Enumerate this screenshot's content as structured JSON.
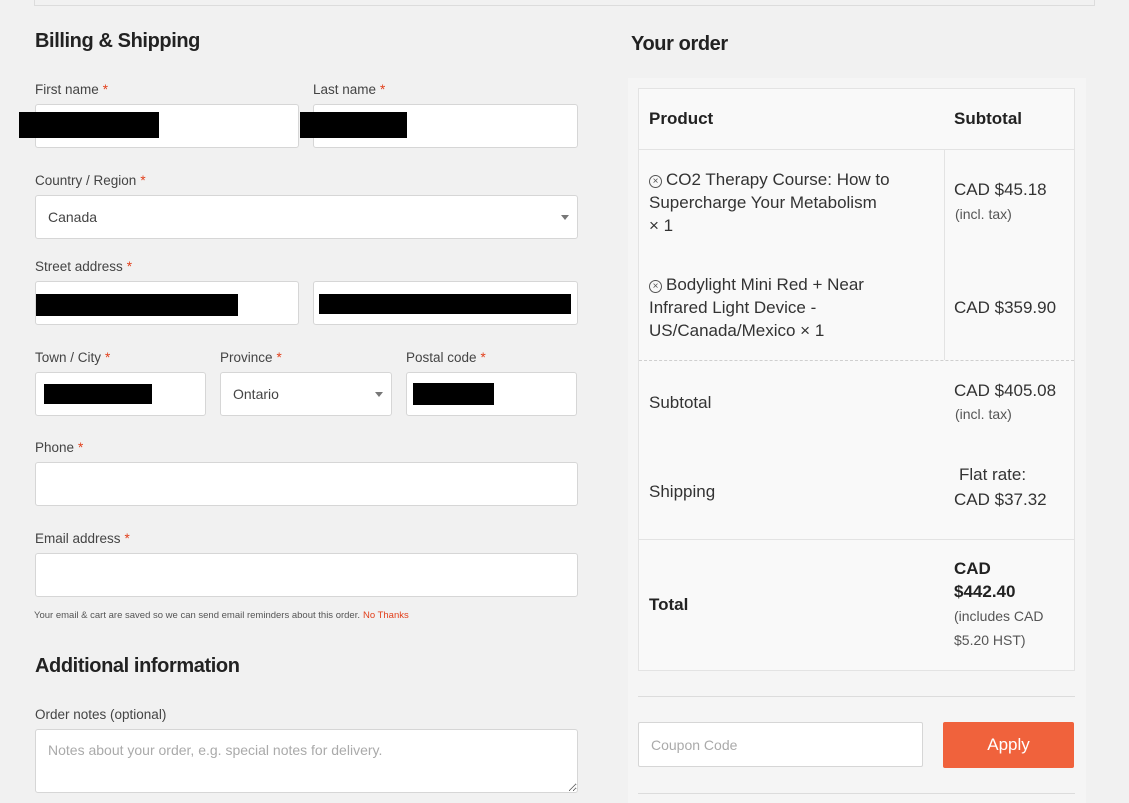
{
  "billing": {
    "title": "Billing & Shipping",
    "required_mark": "*",
    "first_name": {
      "label": "First name",
      "value": ""
    },
    "last_name": {
      "label": "Last name",
      "value": ""
    },
    "country": {
      "label": "Country / Region",
      "value": "Canada"
    },
    "street": {
      "label": "Street address",
      "value_1": "",
      "value_2": ""
    },
    "town": {
      "label": "Town / City",
      "value": ""
    },
    "province": {
      "label": "Province",
      "value": "Ontario"
    },
    "postal": {
      "label": "Postal code",
      "value": ""
    },
    "phone": {
      "label": "Phone",
      "value": ""
    },
    "email": {
      "label": "Email address",
      "value": ""
    },
    "email_note": "Your email & cart are saved so we can send email reminders about this order.",
    "no_thanks": "No Thanks"
  },
  "additional": {
    "title": "Additional information",
    "notes_label": "Order notes (optional)",
    "notes_placeholder": "Notes about your order, e.g. special notes for delivery."
  },
  "order": {
    "title": "Your order",
    "col_product": "Product",
    "col_subtotal": "Subtotal",
    "items": [
      {
        "name_line1": "CO2 Therapy Course: How to",
        "name_line2": "Supercharge Your Metabolism",
        "name_line3": "× 1",
        "price": "CAD $45.18",
        "tax_note": "(incl. tax)"
      },
      {
        "name_line1": "Bodylight Mini Red + Near",
        "name_line2": "Infrared Light Device -",
        "name_line3": "US/Canada/Mexico  × 1",
        "price": "CAD $359.90"
      }
    ],
    "subtotal_label": "Subtotal",
    "subtotal_value": "CAD $405.08",
    "subtotal_tax_note": "(incl. tax)",
    "shipping_label": "Shipping",
    "shipping_line1": "Flat rate:",
    "shipping_line2": "CAD $37.32",
    "total_label": "Total",
    "total_line1": "CAD",
    "total_line2": "$442.40",
    "total_note_line1": "(includes CAD",
    "total_note_line2": "$5.20 HST)"
  },
  "coupon": {
    "placeholder": "Coupon Code",
    "apply_label": "Apply"
  },
  "colors": {
    "accent": "#f0623c",
    "required": "#e2401c"
  }
}
